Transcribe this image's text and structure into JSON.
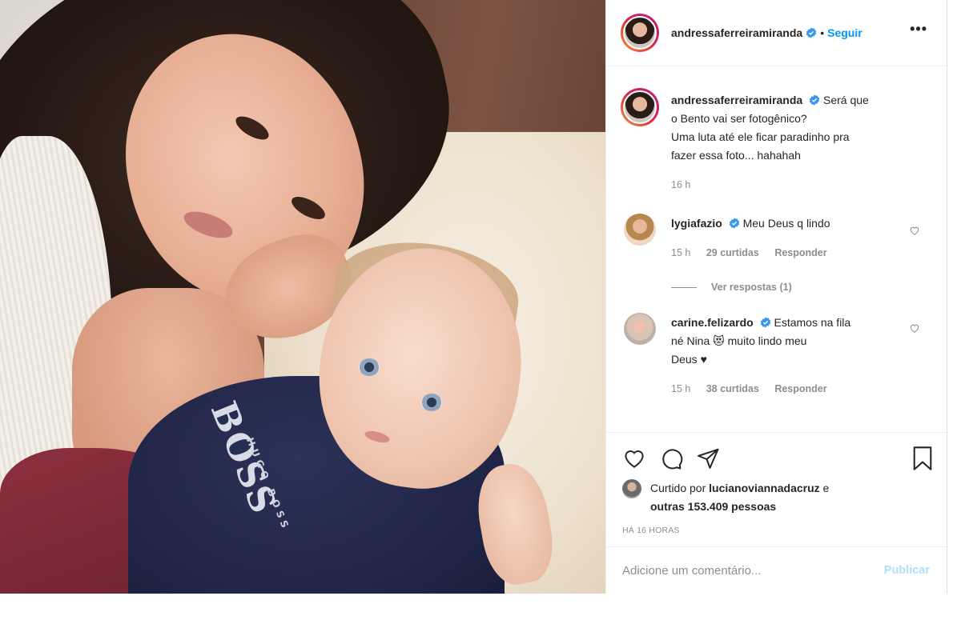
{
  "post": {
    "author": "andressaferreiramiranda",
    "follow_label": "Seguir",
    "separator": "•",
    "more_label": "•••",
    "photo_text": {
      "brand": "BOSS",
      "brand_sub": "HUGO BOSS"
    },
    "caption": {
      "username": "andressaferreiramiranda",
      "text_line1": "Será que",
      "text_rest": "o Bento vai ser fotogênico? Uma luta até ele ficar paradinho pra fazer essa foto... hahahah",
      "line2": "o Bento vai ser fotogênico?",
      "line3": "Uma luta até ele ficar paradinho pra",
      "line4": "fazer essa foto... hahahah",
      "time": "16 h"
    },
    "comments": [
      {
        "username": "lygiafazio",
        "text": "Meu Deus q lindo",
        "time": "15 h",
        "likes": "29 curtidas",
        "reply_label": "Responder",
        "view_replies": "Ver respostas (1)"
      },
      {
        "username": "carine.felizardo",
        "text_a": "Estamos na fila",
        "text_b": "né Nina 😻 muito lindo meu",
        "text_c": "Deus ♥",
        "time": "15 h",
        "likes": "38 curtidas",
        "reply_label": "Responder"
      }
    ],
    "liked_by": {
      "prefix": "Curtido por",
      "user": "lucianoviannadacruz",
      "conj": "e",
      "others": "outras 153.409 pessoas"
    },
    "timestamp": "HÁ 16 HORAS",
    "add_comment_placeholder": "Adicione um comentário...",
    "publish_label": "Publicar"
  },
  "colors": {
    "link_blue": "#0095f6",
    "publish_disabled": "#b2dffc",
    "muted": "#8e8e8e",
    "text": "#262626"
  },
  "icons": [
    "verified-badge-icon",
    "more-options-icon",
    "heart-icon",
    "comment-icon",
    "share-icon",
    "bookmark-icon"
  ]
}
